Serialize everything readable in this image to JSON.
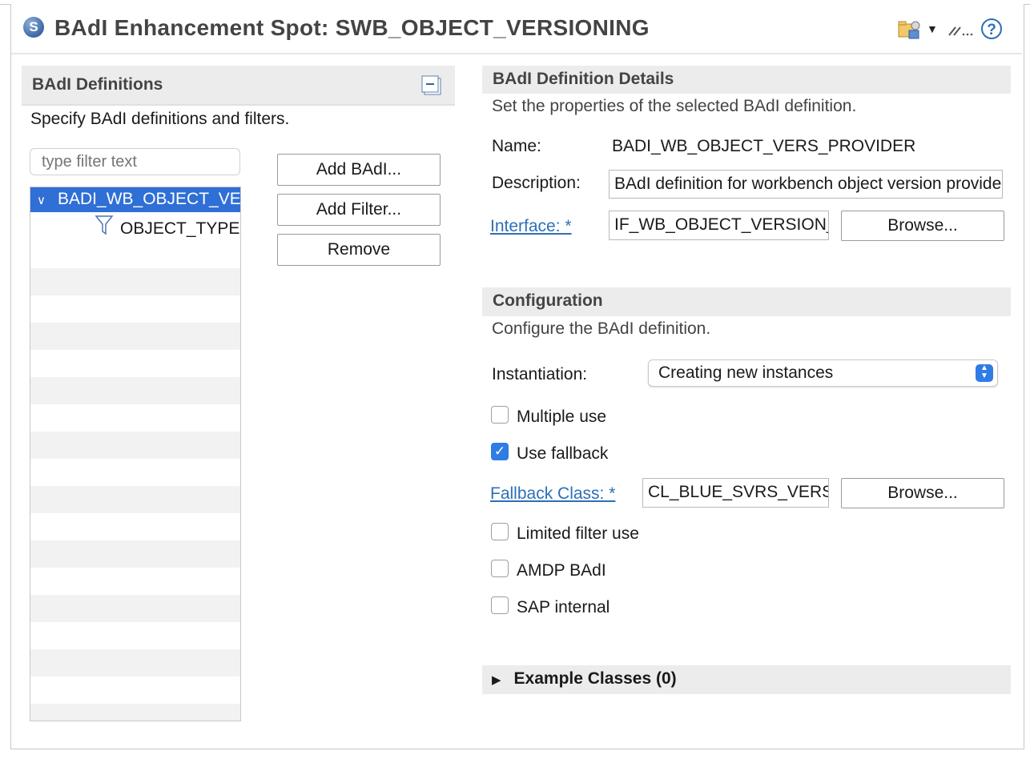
{
  "header": {
    "title": "BAdI Enhancement Spot: SWB_OBJECT_VERSIONING",
    "title_icon_letter": "S",
    "icons": [
      "spot-icon",
      "dropdown-arrow-icon",
      "format-icon",
      "help-icon"
    ],
    "help_glyph": "?"
  },
  "left": {
    "section_title": "BAdI Definitions",
    "description": "Specify BAdI definitions and filters.",
    "filter_placeholder": "type filter text",
    "buttons": {
      "add_badi": "Add BAdI...",
      "add_filter": "Add Filter...",
      "remove": "Remove"
    },
    "tree": [
      {
        "label": "BADI_WB_OBJECT_VERS_PROVIDER",
        "selected": true,
        "expanded": true
      },
      {
        "label": "OBJECT_TYPE",
        "icon": "filter-icon"
      }
    ]
  },
  "details": {
    "section_title": "BAdI Definition Details",
    "description": "Set the properties of the selected BAdI definition.",
    "name_label": "Name:",
    "name_value": "BADI_WB_OBJECT_VERS_PROVIDER",
    "description_label": "Description:",
    "description_value": "BAdI  definition for workbench object version provider",
    "interface_link": "Interface: *",
    "interface_value": "IF_WB_OBJECT_VERSION_PROVIDER",
    "browse_label": "Browse..."
  },
  "config": {
    "section_title": "Configuration",
    "description": "Configure the BAdI definition.",
    "instantiation_label": "Instantiation:",
    "instantiation_value": "Creating new instances",
    "multiple_use": {
      "label": "Multiple use",
      "checked": false
    },
    "use_fallback": {
      "label": "Use fallback",
      "checked": true
    },
    "fallback_link": "Fallback Class: *",
    "fallback_value": "CL_BLUE_SVRS_VERSION_PROVIDER",
    "browse_label": "Browse...",
    "limited_filter": {
      "label": "Limited filter use",
      "checked": false
    },
    "amdp": {
      "label": "AMDP BAdI",
      "checked": false
    },
    "sap_internal": {
      "label": "SAP internal",
      "checked": false
    }
  },
  "examples": {
    "title": "Example Classes (0)"
  },
  "colors": {
    "accent": "#2f6fd6",
    "link": "#2d6fb7",
    "section_bg": "#ececec",
    "checkbox": "#2f7ce5"
  }
}
